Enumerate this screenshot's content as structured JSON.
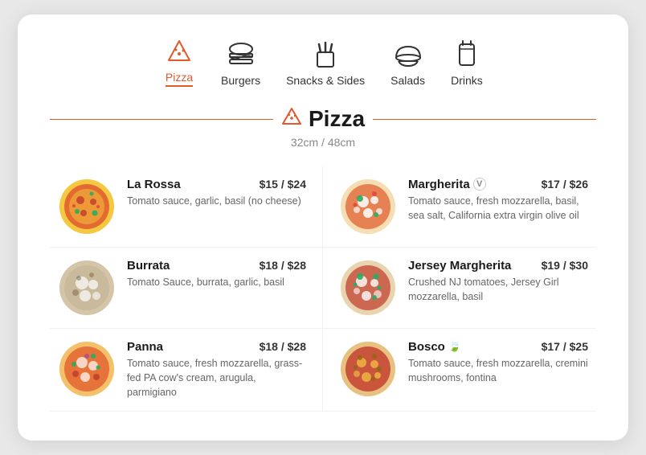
{
  "nav": {
    "items": [
      {
        "id": "pizza",
        "label": "Pizza",
        "active": true
      },
      {
        "id": "burgers",
        "label": "Burgers",
        "active": false
      },
      {
        "id": "snacks",
        "label": "Snacks & Sides",
        "active": false
      },
      {
        "id": "salads",
        "label": "Salads",
        "active": false
      },
      {
        "id": "drinks",
        "label": "Drinks",
        "active": false
      }
    ]
  },
  "section": {
    "title": "Pizza",
    "subtitle": "32cm / 48cm"
  },
  "menu": {
    "items": [
      {
        "id": "la-rossa",
        "name": "La Rossa",
        "price": "$15 / $24",
        "desc": "Tomato sauce, garlic, basil (no cheese)",
        "badge": null,
        "color1": "#c0392b",
        "color2": "#e67e22",
        "color3": "#27ae60"
      },
      {
        "id": "margherita",
        "name": "Margherita",
        "price": "$17 / $26",
        "desc": "Tomato sauce, fresh mozzarella, basil, sea salt, California extra virgin olive oil",
        "badge": "V",
        "color1": "#e74c3c",
        "color2": "#f39c12",
        "color3": "#2ecc71"
      },
      {
        "id": "burrata",
        "name": "Burrata",
        "price": "$18 / $28",
        "desc": "Tomato Sauce, burrata, garlic, basil",
        "badge": null,
        "color1": "#bdc3c7",
        "color2": "#95a5a6",
        "color3": "#7f8c8d"
      },
      {
        "id": "jersey-margherita",
        "name": "Jersey Margherita",
        "price": "$19 / $30",
        "desc": "Crushed NJ tomatoes, Jersey Girl mozzarella, basil",
        "badge": null,
        "color1": "#27ae60",
        "color2": "#2ecc71",
        "color3": "#e74c3c"
      },
      {
        "id": "panna",
        "name": "Panna",
        "price": "$18 / $28",
        "desc": "Tomato sauce, fresh mozzarella, grass-fed PA cow's cream, arugula, parmigiano",
        "badge": null,
        "color1": "#e74c3c",
        "color2": "#f39c12",
        "color3": "#8e44ad"
      },
      {
        "id": "bosco",
        "name": "Bosco",
        "price": "$17 / $25",
        "desc": "Tomato sauce, fresh mozzarella, cremini mushrooms, fontina",
        "badge": "leaf",
        "color1": "#c0392b",
        "color2": "#e67e22",
        "color3": "#d35400"
      }
    ]
  }
}
